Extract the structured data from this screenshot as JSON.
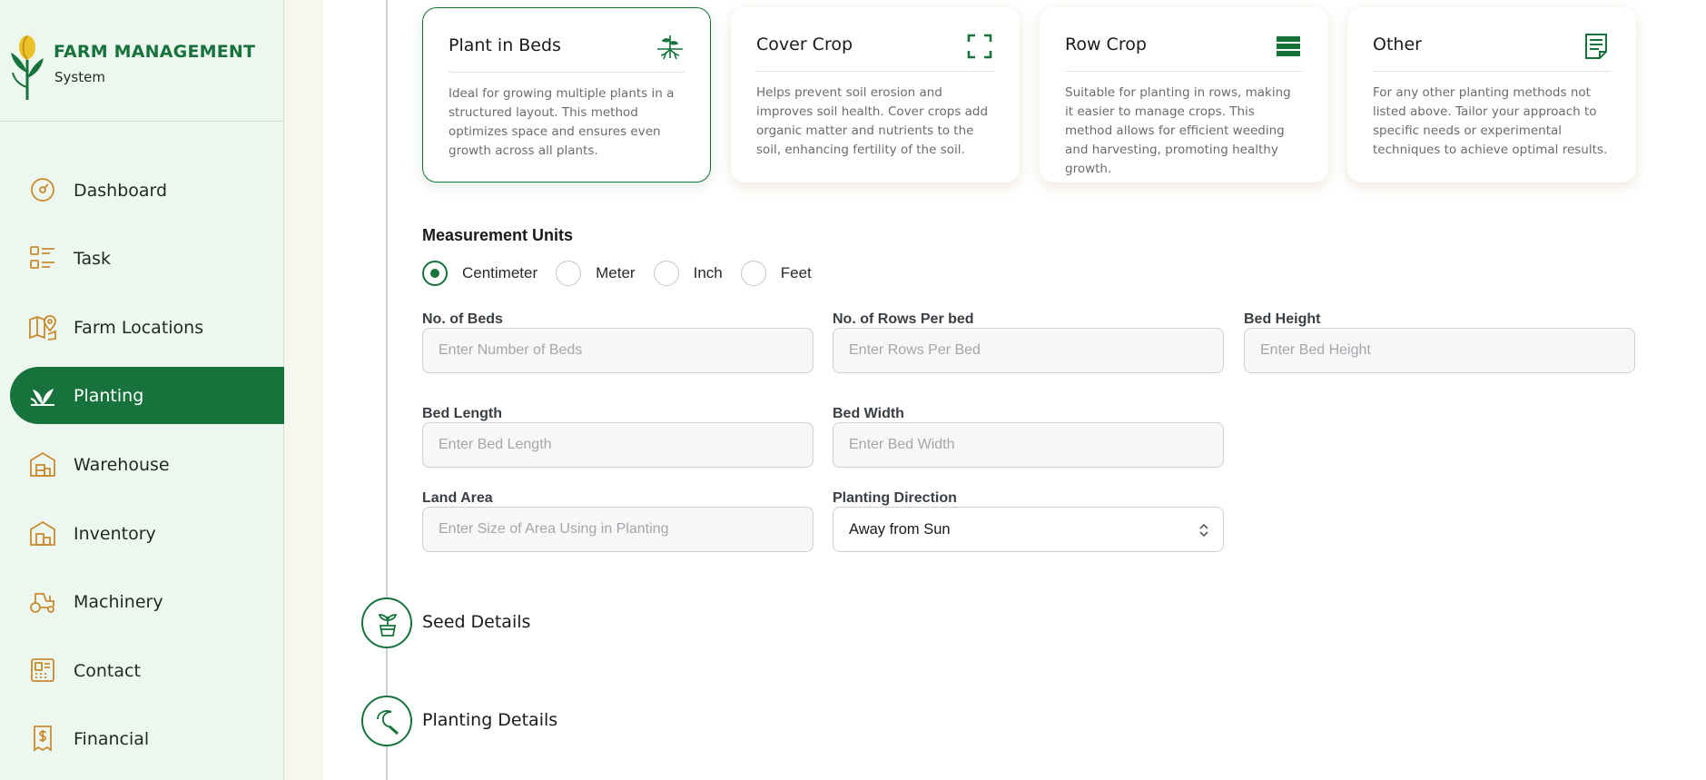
{
  "brand": {
    "title": "FARM MANAGEMENT",
    "subtitle": "System"
  },
  "sidebar": {
    "items": [
      {
        "label": "Dashboard",
        "icon": "gauge-icon",
        "active": false
      },
      {
        "label": "Task",
        "icon": "task-list-icon",
        "active": false
      },
      {
        "label": "Farm Locations",
        "icon": "map-pin-icon",
        "active": false
      },
      {
        "label": "Planting",
        "icon": "sprout-icon",
        "active": true
      },
      {
        "label": "Warehouse",
        "icon": "warehouse-icon",
        "active": false
      },
      {
        "label": "Inventory",
        "icon": "inventory-icon",
        "active": false
      },
      {
        "label": "Machinery",
        "icon": "tractor-icon",
        "active": false
      },
      {
        "label": "Contact",
        "icon": "contact-icon",
        "active": false
      },
      {
        "label": "Financial",
        "icon": "invoice-dollar-icon",
        "active": false
      }
    ]
  },
  "planting_methods": [
    {
      "title": "Plant in Beds",
      "icon": "plant-roots-icon",
      "selected": true,
      "description": "Ideal for growing multiple plants in a structured layout. This method optimizes space and ensures even growth across all plants."
    },
    {
      "title": "Cover Crop",
      "icon": "expand-frame-icon",
      "selected": false,
      "description": "Helps prevent soil erosion and improves soil health. Cover crops add organic matter and nutrients to the soil, enhancing fertility of the soil."
    },
    {
      "title": "Row Crop",
      "icon": "rows-icon",
      "selected": false,
      "description": "Suitable for planting in rows, making it easier to manage crops. This method allows for efficient weeding and harvesting, promoting healthy growth."
    },
    {
      "title": "Other",
      "icon": "document-icon",
      "selected": false,
      "description": "For any other planting methods not listed above. Tailor your approach to specific needs or experimental techniques to achieve optimal results."
    }
  ],
  "measurement": {
    "label": "Measurement Units",
    "options": [
      "Centimeter",
      "Meter",
      "Inch",
      "Feet"
    ],
    "selected": "Centimeter"
  },
  "form": {
    "beds": {
      "label": "No. of Beds",
      "placeholder": "Enter Number of Beds",
      "value": ""
    },
    "rows_per_bed": {
      "label": "No. of Rows Per bed",
      "placeholder": "Enter Rows Per Bed",
      "value": ""
    },
    "bed_height": {
      "label": "Bed Height",
      "placeholder": "Enter Bed Height",
      "value": ""
    },
    "bed_length": {
      "label": "Bed Length",
      "placeholder": "Enter Bed Length",
      "value": ""
    },
    "bed_width": {
      "label": "Bed Width",
      "placeholder": "Enter Bed Width",
      "value": ""
    },
    "land_area": {
      "label": "Land Area",
      "placeholder": "Enter Size of Area Using in Planting",
      "value": ""
    },
    "planting_direction": {
      "label": "Planting Direction",
      "value": "Away from Sun"
    }
  },
  "steps": [
    {
      "label": "Seed Details",
      "icon": "seedling-pot-icon"
    },
    {
      "label": "Planting Details",
      "icon": "sickle-icon"
    }
  ],
  "colors": {
    "primary": "#17723b",
    "sidebar_bg": "#eef7ef",
    "accent_icon": "#c98a2e",
    "page_bg": "#f7f6ef"
  }
}
